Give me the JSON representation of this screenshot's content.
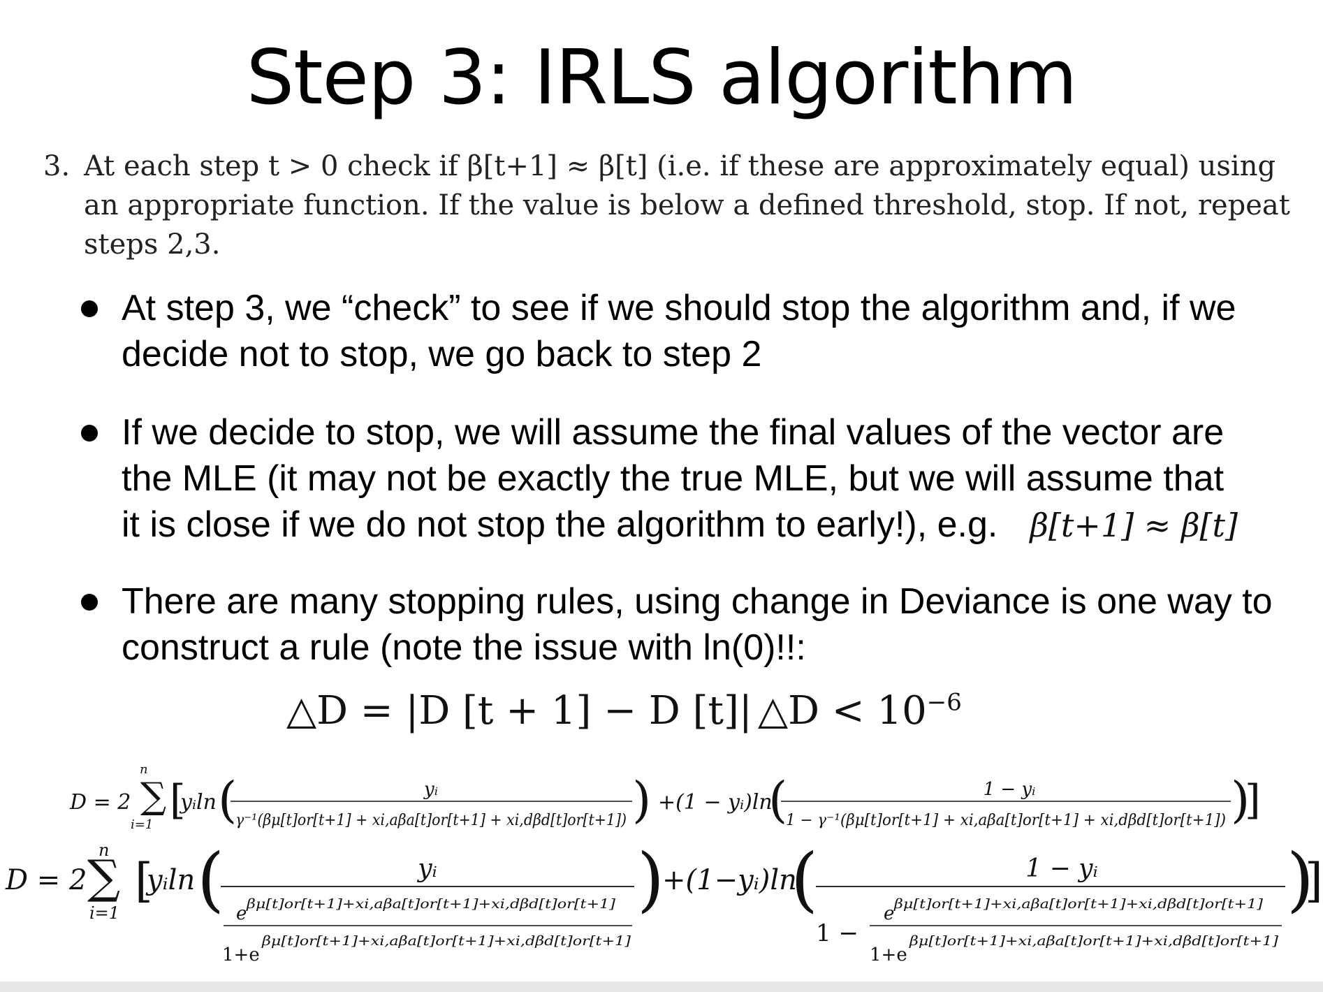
{
  "slide": {
    "title": "Step 3: IRLS algorithm",
    "step3": {
      "number": "3.",
      "line1": "At each step t > 0 check if β[t+1] ≈ β[t] (i.e. if these are approximately equal) using",
      "line2": "an appropriate function.  If the value is below a defined threshold, stop.  If not, repeat",
      "line3": "steps 2,3."
    },
    "bullets": [
      {
        "line1": "At step 3, we “check” to see if we should stop the algorithm and, if we",
        "line2": "decide not to stop, we go back to step 2"
      },
      {
        "line1": "If we decide to stop, we will assume the final values of the vector are",
        "line2": "the MLE (it may not be exactly the true MLE, but we will assume that",
        "line3": "it is close if we do not stop the algorithm to early!), e.g.",
        "math": "β[t+1] ≈ β[t]"
      },
      {
        "line1": "There are many stopping rules, using change in Deviance is one way to",
        "line2": "construct a rule (note the issue with ln(0)!!:"
      }
    ],
    "equations": {
      "delta_def": "△D = |D [t + 1] − D [t]|",
      "delta_rule": "△D < 10",
      "delta_rule_exp": "−6"
    },
    "formula1": {
      "lhs": "D = 2",
      "sum_top": "n",
      "sum_bottom": "i=1",
      "num_left": "yᵢ",
      "den_left": "γ⁻¹(βμ[t]or[t+1] + xi,aβa[t]or[t+1] + xi,dβd[t]or[t+1])",
      "middle": "+(1 − yᵢ)ln",
      "num_right": "1 − yᵢ",
      "den_right": "1 − γ⁻¹(βμ[t]or[t+1] + xi,aβa[t]or[t+1] + xi,dβd[t]or[t+1])"
    },
    "formula2": {
      "lhs": "D = 2",
      "sum_top": "n",
      "sum_bottom": "i=1",
      "num_left": "yᵢ",
      "middle": "+(1−yᵢ)ln",
      "num_right": "1 − yᵢ",
      "one_minus": "1 −",
      "exp_term": "βμ[t]or[t+1]+xi,aβa[t]or[t+1]+xi,dβd[t]or[t+1]",
      "one_plus": "1+e"
    }
  }
}
